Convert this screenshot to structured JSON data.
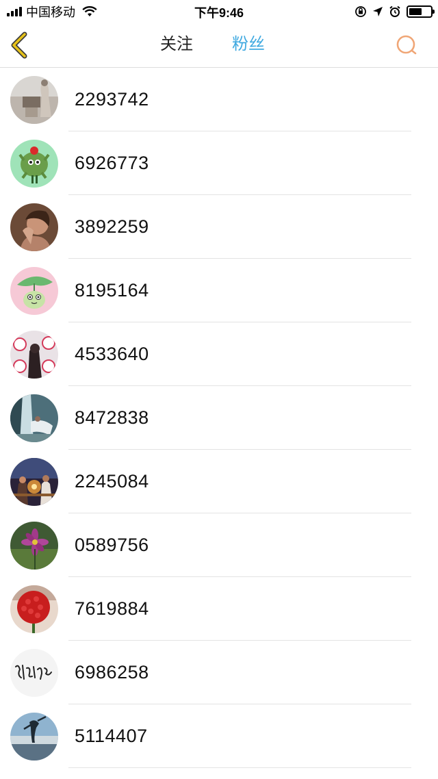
{
  "status_bar": {
    "carrier": "中国移动",
    "time": "下午9:46",
    "battery_level": 0.6
  },
  "nav": {
    "back_icon": "chevron-left-icon",
    "tabs": [
      {
        "label": "关注",
        "active": false
      },
      {
        "label": "粉丝",
        "active": true
      }
    ],
    "search_icon": "search-icon",
    "active_color": "#3fa9e0",
    "back_color": "#e6c21a",
    "search_color": "#f0a676"
  },
  "fans": [
    {
      "id": "2293742",
      "avatar": "avatar-interior-photo"
    },
    {
      "id": "6926773",
      "avatar": "avatar-green-cartoon"
    },
    {
      "id": "3892259",
      "avatar": "avatar-portrait-photo"
    },
    {
      "id": "8195164",
      "avatar": "avatar-frog-cartoon"
    },
    {
      "id": "4533640",
      "avatar": "avatar-cartoon-wall"
    },
    {
      "id": "8472838",
      "avatar": "avatar-waterfall-photo"
    },
    {
      "id": "2245084",
      "avatar": "avatar-candlelight-photo"
    },
    {
      "id": "0589756",
      "avatar": "avatar-purple-flower"
    },
    {
      "id": "7619884",
      "avatar": "avatar-red-roses"
    },
    {
      "id": "6986258",
      "avatar": "avatar-calligraphy"
    },
    {
      "id": "5114407",
      "avatar": "avatar-sky-silhouette"
    }
  ]
}
